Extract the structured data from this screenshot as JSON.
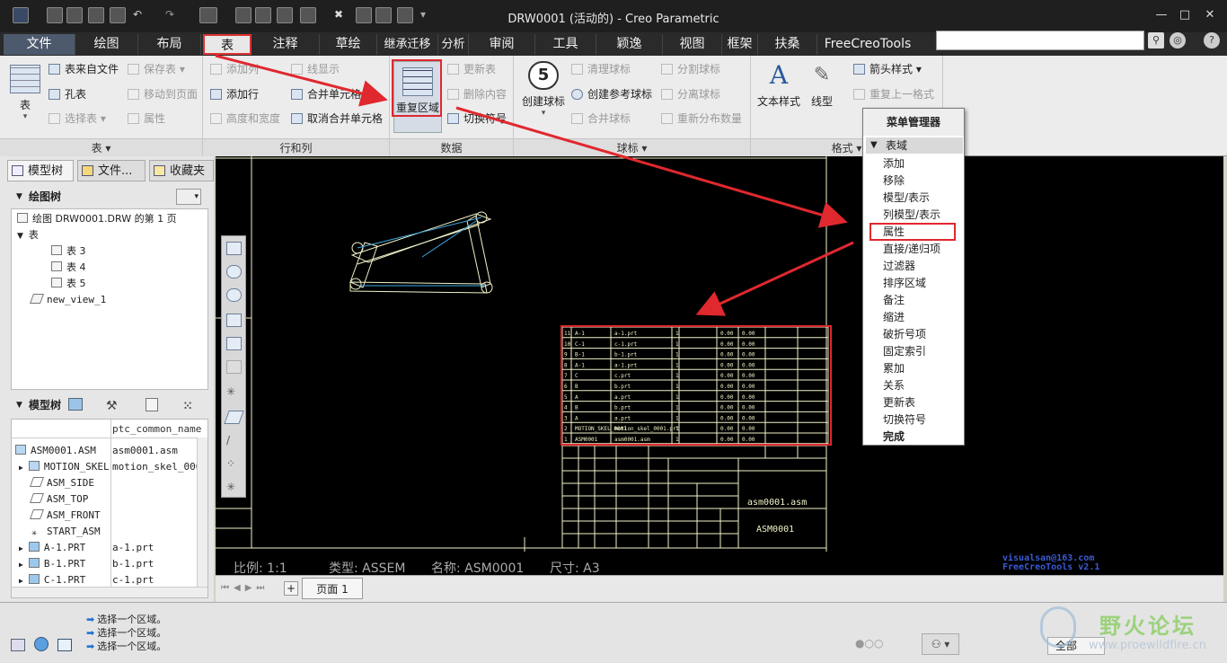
{
  "window": {
    "title": "DRW0001 (活动的) - Creo Parametric",
    "minimize": "—",
    "maximize": "□",
    "close": "✕"
  },
  "tabs": [
    "文件",
    "绘图",
    "布局",
    "表",
    "注释",
    "草绘",
    "继承迁移",
    "分析",
    "审阅",
    "工具",
    "颖逸",
    "视图",
    "框架",
    "扶桑",
    "FreeCreoTools"
  ],
  "active_tab": "表",
  "search": {
    "value": "",
    "placeholder": ""
  },
  "ribbon": {
    "table_group": {
      "title": "表 ▾",
      "big_button": "表",
      "items": [
        "表来自文件",
        "保存表 ▾",
        "孔表",
        "移动到页面",
        "选择表 ▾",
        "属性"
      ]
    },
    "rowcol_group": {
      "title": "行和列",
      "items": [
        "添加列",
        "线显示",
        "添加行",
        "合并单元格",
        "高度和宽度",
        "取消合并单元格"
      ]
    },
    "data_group": {
      "title": "数据",
      "big_button": "重复区域",
      "items": [
        "更新表",
        "删除内容",
        "切换符号"
      ]
    },
    "balloon_group": {
      "title": "球标 ▾",
      "big_button": "创建球标",
      "badge": "5",
      "items": [
        "清理球标",
        "分割球标",
        "创建参考球标",
        "分离球标",
        "合并球标",
        "重新分布数量"
      ]
    },
    "format_group": {
      "title": "格式 ▾",
      "big_buttons": [
        "文本样式",
        "线型"
      ],
      "items": [
        "箭头样式 ▾",
        "重复上一格式"
      ]
    }
  },
  "left_panel": {
    "tabs": [
      "模型树",
      "文件...",
      "收藏夹"
    ],
    "drawing_tree": {
      "title": "绘图树",
      "nodes": [
        "绘图 DRW0001.DRW 的第 1 页",
        "表",
        "表 3",
        "表 4",
        "表 5",
        "new_view_1"
      ]
    },
    "model_tree": {
      "title": "模型树",
      "column": "ptc_common_name",
      "rows": [
        {
          "name": "ASM0001.ASM",
          "value": "asm0001.asm"
        },
        {
          "name": "MOTION_SKEL",
          "value": "motion_skel_0001"
        },
        {
          "name": "ASM_SIDE",
          "value": ""
        },
        {
          "name": "ASM_TOP",
          "value": ""
        },
        {
          "name": "ASM_FRONT",
          "value": ""
        },
        {
          "name": "START_ASM",
          "value": ""
        },
        {
          "name": "A-1.PRT",
          "value": "a-1.prt"
        },
        {
          "name": "B-1.PRT",
          "value": "b-1.prt"
        },
        {
          "name": "C-1.PRT",
          "value": "c-1.prt"
        }
      ]
    }
  },
  "canvas": {
    "info": {
      "scale": "比例: 1:1",
      "type": "类型: ASSEM",
      "name": "名称: ASM0001",
      "size": "尺寸: A3"
    },
    "watermark_email": "visualsan@163.com",
    "watermark_tool": "FreeCreoTools v2.1",
    "title_block": {
      "file": "asm0001.asm",
      "name": "ASM0001"
    },
    "bom_rows": [
      [
        "11",
        "A-1",
        "a-1.prt",
        "1",
        "0.00",
        "0.00"
      ],
      [
        "10",
        "C-1",
        "c-1.prt",
        "1",
        "0.00",
        "0.00"
      ],
      [
        "9",
        "B-1",
        "b-1.prt",
        "1",
        "0.00",
        "0.00"
      ],
      [
        "8",
        "A-1",
        "a-1.prt",
        "1",
        "0.00",
        "0.00"
      ],
      [
        "7",
        "C",
        "c.prt",
        "1",
        "0.00",
        "0.00"
      ],
      [
        "6",
        "B",
        "b.prt",
        "1",
        "0.00",
        "0.00"
      ],
      [
        "5",
        "A",
        "a.prt",
        "1",
        "0.00",
        "0.00"
      ],
      [
        "4",
        "B",
        "b.prt",
        "1",
        "0.00",
        "0.00"
      ],
      [
        "3",
        "A",
        "a.prt",
        "1",
        "0.00",
        "0.00"
      ],
      [
        "2",
        "MOTION_SKEL_0001",
        "motion_skel_0001.prt",
        "1",
        "0.00",
        "0.00"
      ],
      [
        "1",
        "ASM0001",
        "asm0001.asm",
        "1",
        "0.00",
        "0.00"
      ]
    ]
  },
  "page_tab": "页面 1",
  "menu_manager": {
    "title": "菜单管理器",
    "section": "表域",
    "items": [
      "添加",
      "移除",
      "模型/表示",
      "列模型/表示",
      "属性",
      "直接/递归项",
      "过滤器",
      "排序区域",
      "备注",
      "缩进",
      "破折号项",
      "固定索引",
      "累加",
      "关系",
      "更新表",
      "切换符号",
      "完成"
    ],
    "highlighted": "属性"
  },
  "status_messages": [
    "选择一个区域。",
    "选择一个区域。",
    "选择一个区域。"
  ],
  "filter": {
    "value": "全部"
  },
  "forum_logo": {
    "name": "野火论坛",
    "url": "www.proewildfire.cn"
  },
  "colors": {
    "highlight": "#e0282f",
    "canvas": "#000000",
    "drawing_lines": "#f2f2c8",
    "title_bar": "#1f1f1f"
  }
}
